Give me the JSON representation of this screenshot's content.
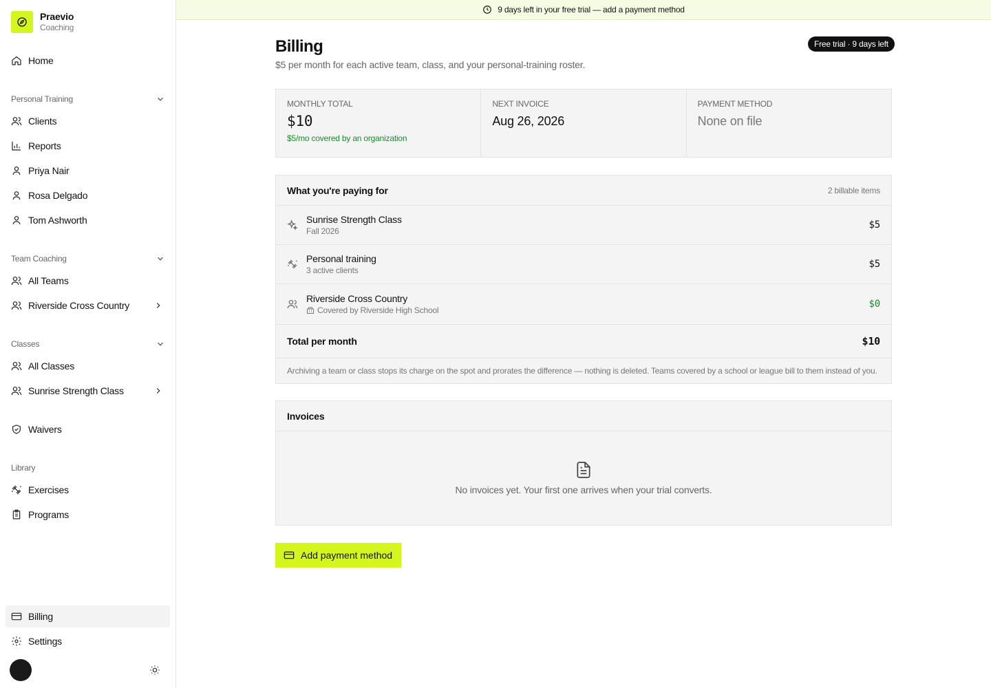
{
  "brand": {
    "name": "Praevio",
    "sub": "Coaching"
  },
  "nav": {
    "home": "Home",
    "personal_training": {
      "label": "Personal Training",
      "items": [
        "Clients",
        "Reports",
        "Priya Nair",
        "Rosa Delgado",
        "Tom Ashworth"
      ]
    },
    "team_coaching": {
      "label": "Team Coaching",
      "items": [
        "All Teams",
        "Riverside Cross Country"
      ]
    },
    "classes": {
      "label": "Classes",
      "items": [
        "All Classes",
        "Sunrise Strength Class"
      ]
    },
    "waivers": "Waivers",
    "library": {
      "label": "Library",
      "items": [
        "Exercises",
        "Programs"
      ]
    },
    "billing": "Billing",
    "settings": "Settings"
  },
  "banner": {
    "text": "9 days left in your free trial — add a payment method"
  },
  "header": {
    "title": "Billing",
    "subtitle": "$5 per month for each active team, class, and your personal-training roster.",
    "badge": "Free trial · 9 days left"
  },
  "stats": {
    "monthly_total": {
      "label": "MONTHLY TOTAL",
      "value": "$10",
      "note": "$5/mo covered by an organization"
    },
    "next_invoice": {
      "label": "NEXT INVOICE",
      "value": "Aug 26, 2026"
    },
    "payment_method": {
      "label": "PAYMENT METHOD",
      "value": "None on file"
    }
  },
  "paying_for": {
    "title": "What you're paying for",
    "meta": "2 billable items",
    "items": [
      {
        "name": "Sunrise Strength Class",
        "sub": "Fall 2026",
        "amount": "$5",
        "icon": "sparkles-icon"
      },
      {
        "name": "Personal training",
        "sub": "3 active clients",
        "amount": "$5",
        "icon": "dumbbell-icon"
      },
      {
        "name": "Riverside Cross Country",
        "sub": "Covered by Riverside High School",
        "amount": "$0",
        "icon": "users-icon"
      }
    ],
    "total_label": "Total per month",
    "total_amount": "$10",
    "footnote": "Archiving a team or class stops its charge on the spot and prorates the difference — nothing is deleted. Teams covered by a school or league bill to them instead of you."
  },
  "invoices": {
    "title": "Invoices",
    "empty": "No invoices yet. Your first one arrives when your trial converts."
  },
  "actions": {
    "add_payment": "Add payment method"
  },
  "colors": {
    "accent": "#d4f61e",
    "green": "#1a8a2c",
    "banner_bg": "#f6fbe3"
  }
}
